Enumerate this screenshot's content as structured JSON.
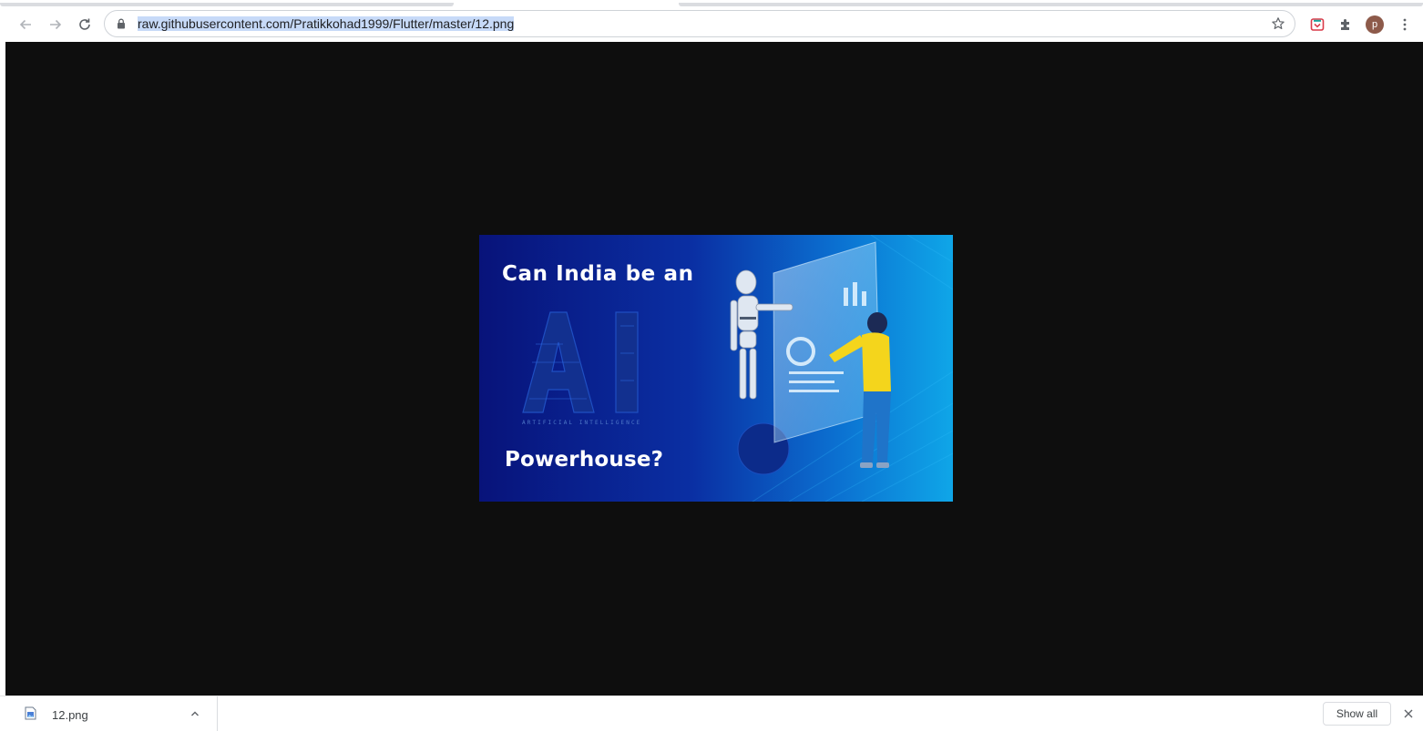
{
  "browser": {
    "url_display": "raw.githubusercontent.com/Pratikkohad1999/Flutter/master/12.png",
    "profile_initial": "p",
    "icons": {
      "back": "back-arrow-icon",
      "forward": "forward-arrow-icon",
      "reload": "reload-icon",
      "lock": "lock-icon",
      "bookmark": "star-icon",
      "extension_1": "pocket-icon",
      "extensions": "puzzle-icon",
      "menu": "kebab-menu-icon"
    },
    "colors": {
      "accent": "#1a73e8",
      "selection": "#c7daf8",
      "avatar": "#8d5a4a",
      "viewer_background": "#0e0e0e"
    }
  },
  "viewer": {
    "image": {
      "line_1": "Can India be an",
      "line_2": "Powerhouse?",
      "big_letters": "AI",
      "subtitle": "ARTIFICIAL INTELLIGENCE"
    }
  },
  "download_shelf": {
    "items": [
      {
        "filename": "12.png",
        "icon": "image-file-icon"
      }
    ],
    "show_all_label": "Show all",
    "close_icon": "close-icon"
  }
}
